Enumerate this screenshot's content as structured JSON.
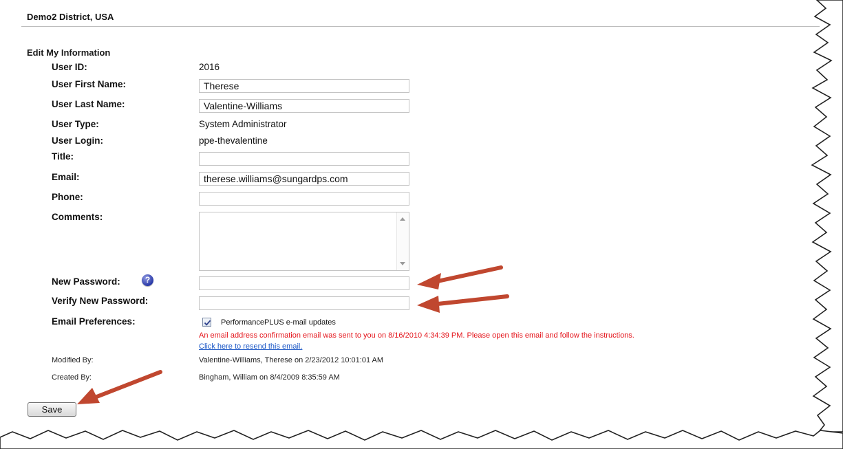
{
  "header": {
    "district": "Demo2 District, USA"
  },
  "form": {
    "title": "Edit My Information",
    "user_id": {
      "label": "User ID:",
      "value": "2016"
    },
    "first_name": {
      "label": "User First Name:",
      "value": "Therese"
    },
    "last_name": {
      "label": "User Last Name:",
      "value": "Valentine-Williams"
    },
    "user_type": {
      "label": "User Type:",
      "value": "System Administrator"
    },
    "user_login": {
      "label": "User Login:",
      "value": "ppe-thevalentine"
    },
    "title_field": {
      "label": "Title:",
      "value": ""
    },
    "email": {
      "label": "Email:",
      "value": "therese.williams@sungardps.com"
    },
    "phone": {
      "label": "Phone:",
      "value": ""
    },
    "comments": {
      "label": "Comments:",
      "value": ""
    },
    "new_password": {
      "label": "New Password:",
      "value": ""
    },
    "verify_password": {
      "label": "Verify New Password:",
      "value": ""
    },
    "email_prefs": {
      "label": "Email Preferences:",
      "checkbox_label": "PerformancePLUS e-mail updates",
      "checked": true,
      "notice": "An email address confirmation email was sent to you on 8/16/2010 4:34:39 PM. Please open this email and follow the instructions.",
      "resend_link": "Click here to resend this email."
    },
    "modified_by": {
      "label": "Modified By:",
      "value": "Valentine-Williams, Therese on 2/23/2012 10:01:01 AM"
    },
    "created_by": {
      "label": "Created By:",
      "value": "Bingham, William on 8/4/2009 8:35:59 AM"
    },
    "save_label": "Save"
  },
  "icons": {
    "help": "help-question-icon",
    "check": "check-icon",
    "arrow": "red-arrow-annotation"
  },
  "colors": {
    "notice": "#e4141b",
    "link": "#1b57c6",
    "arrow": "#c0472f",
    "help_icon": "#2a3aa8"
  }
}
